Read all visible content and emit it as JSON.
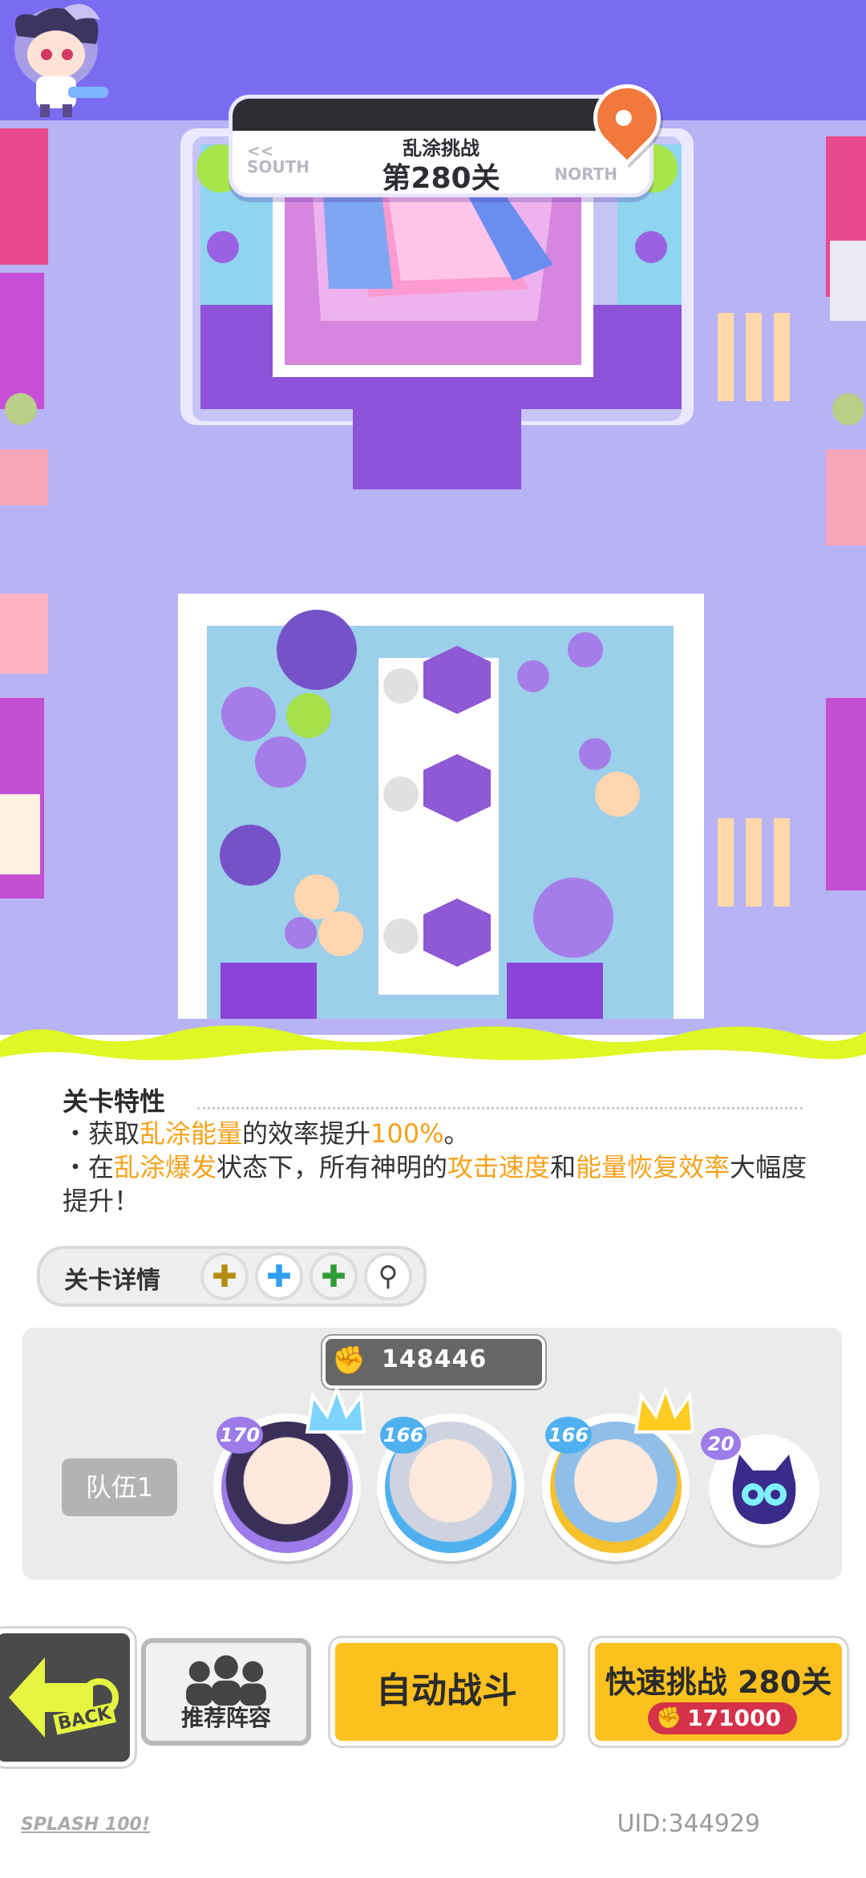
{
  "map": {
    "mode_label": "乱涂挑战",
    "stage_label": "第280关",
    "left_direction": "SOUTH",
    "right_direction": "NORTH",
    "left_arrow": "<<"
  },
  "stage_traits": {
    "title": "关卡特性",
    "line1": {
      "prefix": "・获取",
      "h1": "乱涂能量",
      "mid": "的效率提升",
      "h2": "100%",
      "suffix": "。"
    },
    "line2": {
      "prefix": "・在",
      "h1": "乱涂爆发",
      "mid": "状态下，所有神明的",
      "h2": "攻击速度",
      "and": "和",
      "h3": "能量恢复效率",
      "suffix": "大幅度提升！"
    }
  },
  "stage_details": {
    "label": "关卡详情",
    "icons": [
      {
        "name": "puzzle-icon-gold",
        "color": "#b48c10"
      },
      {
        "name": "puzzle-icon-blue",
        "color": "#2f9ef5"
      },
      {
        "name": "puzzle-icon-green",
        "color": "#2f9b38"
      },
      {
        "name": "magnifier-icon",
        "color": "#444444"
      }
    ]
  },
  "team": {
    "power": "148446",
    "team_label": "队伍1",
    "heroes": [
      {
        "level": "170",
        "ring": "#9d7be8",
        "crown": "blue"
      },
      {
        "level": "166",
        "ring": "#4fb0f0",
        "crown": "none"
      },
      {
        "level": "166",
        "ring": "#f6c12a",
        "crown": "gold"
      }
    ],
    "pet": {
      "level": "20"
    }
  },
  "buttons": {
    "back": "BACK",
    "recommend": "推荐阵容",
    "auto": "自动战斗",
    "quick": "快速挑战 280关",
    "quick_cost": "171000"
  },
  "footer": {
    "logo": "SPLASH 100!",
    "uid": "UID:344929"
  },
  "colors": {
    "accent_yellow": "#fcc11f",
    "highlight_orange": "#f7a21b",
    "splash_lime": "#dff724",
    "map_purple": "#7a6cf0"
  }
}
